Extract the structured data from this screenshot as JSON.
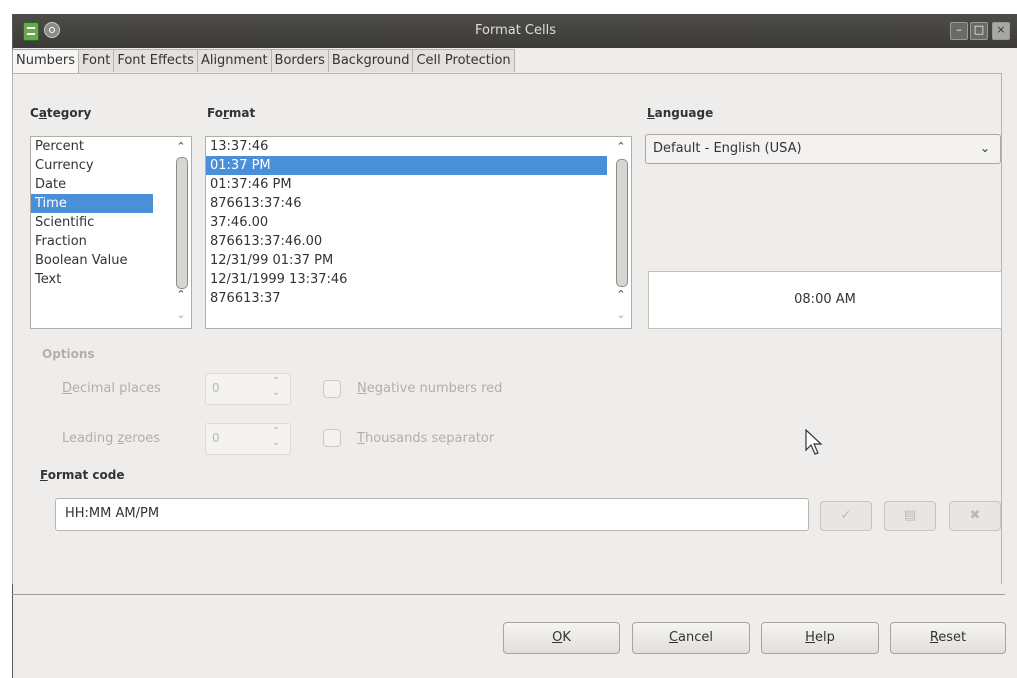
{
  "window": {
    "title": "Format Cells"
  },
  "tabs": [
    "Numbers",
    "Font",
    "Font Effects",
    "Alignment",
    "Borders",
    "Background",
    "Cell Protection"
  ],
  "category": {
    "label_pre": "C",
    "label_u": "a",
    "label_post": "tegory",
    "items": [
      "Percent",
      "Currency",
      "Date",
      "Time",
      "Scientific",
      "Fraction",
      "Boolean Value",
      "Text"
    ],
    "selected_index": 3
  },
  "format": {
    "label_pre": "Fo",
    "label_u": "r",
    "label_post": "mat",
    "items": [
      "13:37:46",
      "01:37 PM",
      "01:37:46 PM",
      "876613:37:46",
      "37:46.00",
      "876613:37:46.00",
      "12/31/99 01:37 PM",
      "12/31/1999 13:37:46",
      "876613:37"
    ],
    "selected_index": 1
  },
  "language": {
    "label_u": "L",
    "label_post": "anguage",
    "value": "Default - English (USA)"
  },
  "preview": "08:00 AM",
  "options": {
    "label": "Options",
    "decimal_places_u": "D",
    "decimal_places_rest": "ecimal places",
    "decimal_places_value": "0",
    "leading_zeroes_pre": "Leading ",
    "leading_zeroes_u": "z",
    "leading_zeroes_post": "eroes",
    "leading_zeroes_value": "0",
    "negative_red_u": "N",
    "negative_red_rest": "egative numbers red",
    "thousands_u": "T",
    "thousands_rest": "housands separator"
  },
  "format_code": {
    "label_u": "F",
    "label_post": "ormat code",
    "value": "HH:MM AM/PM"
  },
  "buttons": {
    "ok_u": "O",
    "ok_rest": "K",
    "cancel_u": "C",
    "cancel_rest": "ancel",
    "help_u": "H",
    "help_rest": "elp",
    "reset_u": "R",
    "reset_rest": "eset"
  },
  "colors": {
    "selection": "#4a90d9",
    "titlebar": "#3c3b37",
    "dialog_bg": "#efedeb"
  }
}
